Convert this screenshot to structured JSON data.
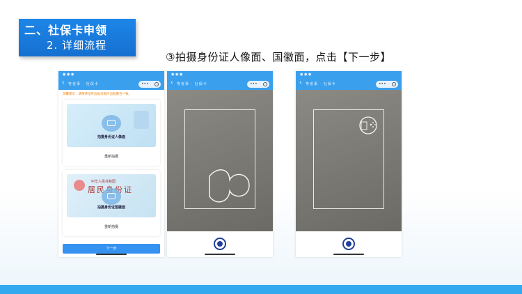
{
  "header": {
    "section_title": "二、社保卡申领",
    "subsection_title": "2. 详细流程"
  },
  "step_caption": "③拍摄身份证人像面、国徽面，点击【下一步】",
  "phone_screens": {
    "screen1": {
      "nav_title": "粤省事 · 社保卡",
      "notice": "温馨提示：请保持证件边框与图片边框重合一致。",
      "front_card": {
        "label": "拍摄身份证人像面",
        "reshoot": "重新拍摄"
      },
      "back_card": {
        "national_name": "中华人民共和国",
        "id_word": "居民身份证",
        "label": "拍摄身份证国徽面",
        "reshoot": "重新拍摄"
      },
      "next_button": "下一步"
    },
    "screen2": {
      "nav_title": "粤省事 · 社保卡"
    },
    "screen3": {
      "nav_title": "粤省事 · 社保卡"
    }
  },
  "icons": {
    "back": "chevron-left-icon",
    "camera": "camera-icon",
    "shutter": "shutter-icon",
    "portrait_outline": "portrait-outline-icon",
    "emblem_outline": "national-emblem-outline-icon"
  },
  "colors": {
    "title_box": "#1d86e8",
    "app_bar": "#3aa0ee",
    "next_button": "#3592f0",
    "shutter": "#1f3f9a",
    "bottom_bar": "#33aaf0"
  }
}
